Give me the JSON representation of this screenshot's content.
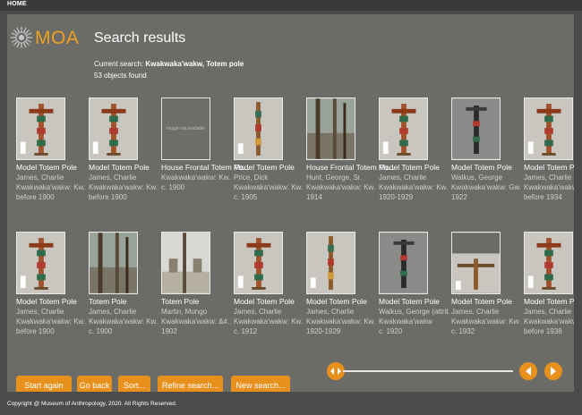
{
  "nav": {
    "home": "HOME"
  },
  "brand": {
    "logo_text": "MOA",
    "accent": "#e8901c"
  },
  "header": {
    "title": "Search results",
    "current_label": "Current search:",
    "current_query": "Kwakwaka'wakw, Totem pole",
    "count": "53 objects found"
  },
  "rows": [
    {
      "items": [
        {
          "title": "Model Totem Pole",
          "lines": [
            "James, Charlie",
            "Kwakwaka'wakw: Kw...",
            "before 1900"
          ],
          "image": "totem"
        },
        {
          "title": "Model Totem Pole",
          "lines": [
            "James, Charlie",
            "Kwakwaka'wakw: Kw...",
            "before 1900"
          ],
          "image": "totem"
        },
        {
          "title": "House Frontal Totem Po...",
          "lines": [
            "Kwakwaka'wakw: Kw...",
            "c. 1900"
          ],
          "image": "na",
          "na_text": "image not available"
        },
        {
          "title": "Model Totem Pole",
          "lines": [
            "Price, Dick",
            "Kwakwaka'wakw: Kw...",
            "c. 1905"
          ],
          "image": "totem-thin"
        },
        {
          "title": "House Frontal Totem Po...",
          "lines": [
            "Hunt, George, Sr.",
            "Kwakwaka'wakw: Kw...",
            "1914"
          ],
          "image": "photo"
        },
        {
          "title": "Model Totem Pole",
          "lines": [
            "James, Charlie",
            "Kwakwaka'wakw: Kw...",
            "1920-1929"
          ],
          "image": "totem"
        },
        {
          "title": "Model Totem Pole",
          "lines": [
            "Walkus, George",
            "Kwakwaka'wakw: Gw...",
            "1922"
          ],
          "image": "totem-dark"
        },
        {
          "title": "Model Totem Pole",
          "lines": [
            "James, Charlie",
            "Kwakwaka'wakw: Kw...",
            "before 1934"
          ],
          "image": "totem"
        }
      ]
    },
    {
      "items": [
        {
          "title": "Model Totem Pole",
          "lines": [
            "James, Charlie",
            "Kwakwaka'wakw: Kw...",
            "before 1900"
          ],
          "image": "totem"
        },
        {
          "title": "Totem Pole",
          "lines": [
            "James, Charlie",
            "Kwakwaka'wakw: Kw...",
            "c. 1900"
          ],
          "image": "photo"
        },
        {
          "title": "Totem Pole",
          "lines": [
            "Martin, Mungo",
            "Kwakwaka'wakw: &#...",
            "1902"
          ],
          "image": "photo-light"
        },
        {
          "title": "Model Totem Pole",
          "lines": [
            "James, Charlie",
            "Kwakwaka'wakw: Kw...",
            "c. 1912"
          ],
          "image": "totem"
        },
        {
          "title": "Model Totem Pole",
          "lines": [
            "James, Charlie",
            "Kwakwaka'wakw: Kw...",
            "1920-1929"
          ],
          "image": "totem-thin"
        },
        {
          "title": "Model Totem Pole",
          "lines": [
            "Walkus, George (attrib...",
            "Kwakwaka'wakw",
            "c. 1920"
          ],
          "image": "totem-dark"
        },
        {
          "title": "Model Totem Pole",
          "lines": [
            "James, Charlie",
            "Kwakwaka'wakw: Kw...",
            "c. 1932"
          ],
          "image": "cross"
        },
        {
          "title": "Model Totem Pole",
          "lines": [
            "James, Charlie",
            "Kwakwaka'wakw: Kw...",
            "before 1938"
          ],
          "image": "totem"
        }
      ]
    }
  ],
  "actions": {
    "start_again": "Start again",
    "go_back": "Go back",
    "sort": "Sort...",
    "refine": "Refine search...",
    "new_search": "New search..."
  },
  "pager": {
    "icons": [
      "collapse-arrows-icon",
      "prev-arrow-icon",
      "next-arrow-icon"
    ]
  },
  "footer": {
    "copyright": "Copyright @ Museum of Anthropology, 2020. All Rights Reserved."
  }
}
